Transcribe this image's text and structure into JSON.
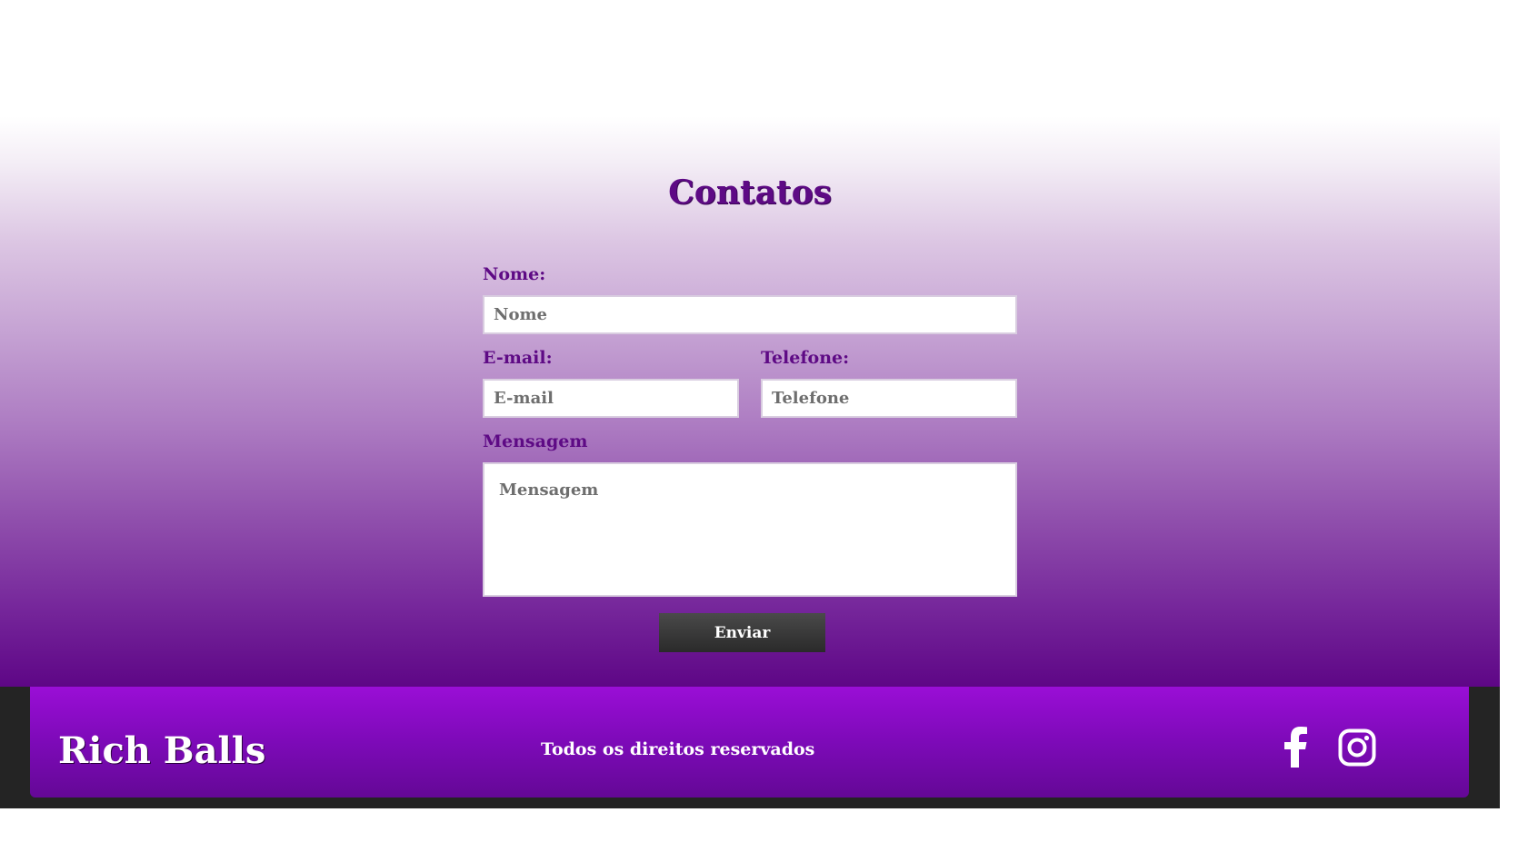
{
  "contact": {
    "title": "Contatos",
    "name_label": "Nome:",
    "name_placeholder": "Nome",
    "email_label": "E-mail:",
    "email_placeholder": "E-mail",
    "phone_label": "Telefone:",
    "phone_placeholder": "Telefone",
    "message_label": "Mensagem",
    "message_placeholder": "Mensagem",
    "submit_label": "Enviar"
  },
  "footer": {
    "brand": "Rich Balls",
    "copyright": "Todos os direitos reservados",
    "social": [
      {
        "icon": "facebook-icon"
      },
      {
        "icon": "instagram-icon"
      }
    ]
  },
  "colors": {
    "accent_purple": "#5e0a85",
    "footer_purple": "#8a0cc8",
    "footer_dark": "#242424",
    "button_dark": "#3a3a3a"
  }
}
